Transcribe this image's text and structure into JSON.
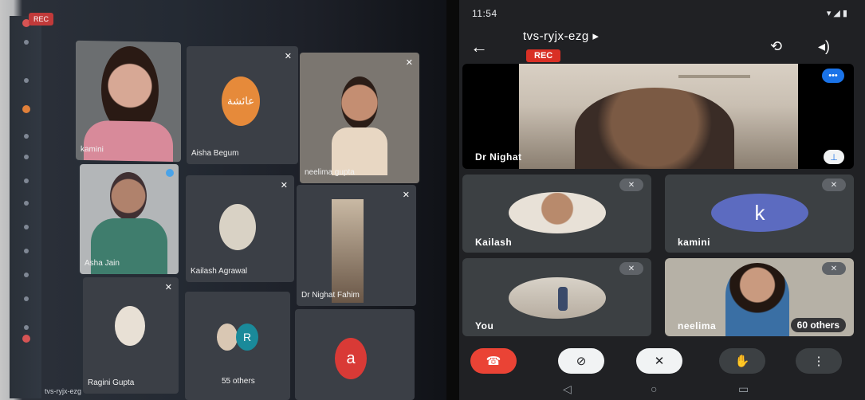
{
  "left_photo": {
    "rec_badge": "REC",
    "meeting_code": "tvs-ryjx-ezg",
    "tiles": [
      {
        "name": "kamini",
        "muted": false
      },
      {
        "name": "Aisha Begum",
        "muted": true,
        "avatar_text": "عائشة"
      },
      {
        "name": "neelima gupta",
        "muted": true
      },
      {
        "name": "Asha Jain",
        "muted": false
      },
      {
        "name": "Kailash Agrawal",
        "muted": true
      },
      {
        "name": "Dr Nighat Fahim",
        "muted": true
      },
      {
        "name": "Ragini Gupta",
        "muted": true
      },
      {
        "name": "55 others",
        "muted": false,
        "avatar_letter": "R"
      },
      {
        "name": "",
        "muted": false,
        "avatar_letter": "a"
      }
    ]
  },
  "phone": {
    "status_time": "11:54",
    "meeting_title": "tvs-ryjx-ezg",
    "rec_badge": "REC",
    "back_icon": "←",
    "main_speaker": "Dr Nighat",
    "tiles": [
      {
        "name": "Kailash",
        "muted": true
      },
      {
        "name": "kamini",
        "muted": true,
        "avatar_letter": "k",
        "avatar_color": "#5c6bc0"
      },
      {
        "name": "You",
        "muted": true
      },
      {
        "name": "neelima",
        "muted": true,
        "others": "60 others"
      }
    ],
    "controls": {
      "end_call": "end-call",
      "camera": "camera-off",
      "microphone": "mic-off",
      "raise_hand": "raise-hand",
      "more": "more-options"
    },
    "colors": {
      "end_call": "#ea4335",
      "rec": "#d93025",
      "accent": "#1a73e8"
    }
  }
}
